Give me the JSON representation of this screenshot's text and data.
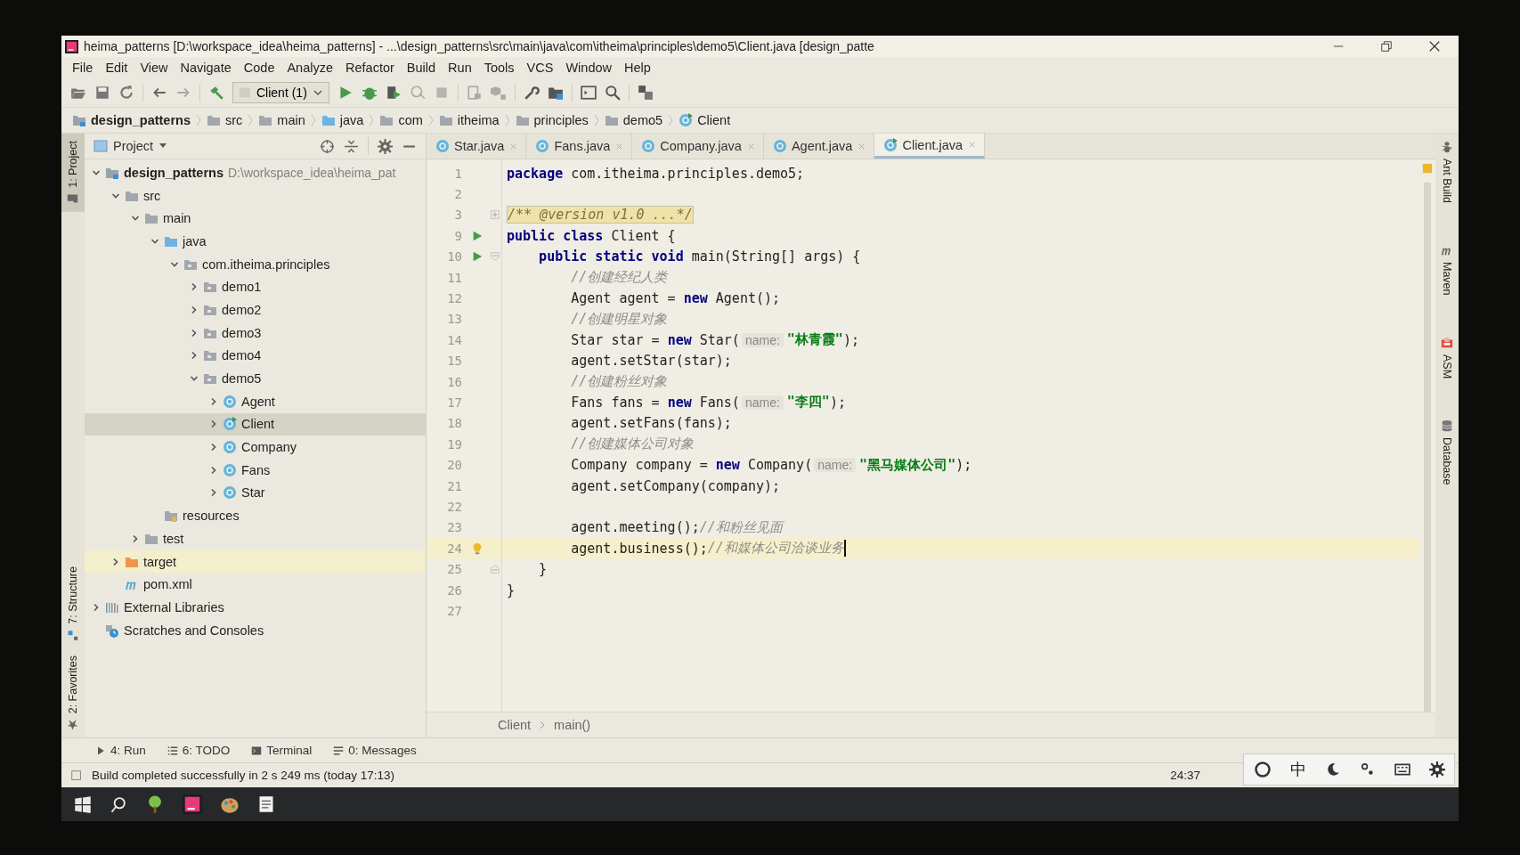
{
  "window": {
    "title": "heima_patterns [D:\\workspace_idea\\heima_patterns] - ...\\design_patterns\\src\\main\\java\\com\\itheima\\principles\\demo5\\Client.java [design_patte"
  },
  "menu": [
    "File",
    "Edit",
    "View",
    "Navigate",
    "Code",
    "Analyze",
    "Refactor",
    "Build",
    "Run",
    "Tools",
    "VCS",
    "Window",
    "Help"
  ],
  "toolbar": {
    "run_config": "Client (1)"
  },
  "breadcrumbs": [
    {
      "label": "design_patterns",
      "kind": "module"
    },
    {
      "label": "src",
      "kind": "folder"
    },
    {
      "label": "main",
      "kind": "folder"
    },
    {
      "label": "java",
      "kind": "source"
    },
    {
      "label": "com",
      "kind": "package"
    },
    {
      "label": "itheima",
      "kind": "package"
    },
    {
      "label": "principles",
      "kind": "package"
    },
    {
      "label": "demo5",
      "kind": "package"
    },
    {
      "label": "Client",
      "kind": "class"
    }
  ],
  "left_strip": [
    {
      "label": "1: Project",
      "selected": true
    },
    {
      "label": "7: Structure",
      "selected": false
    },
    {
      "label": "2: Favorites",
      "selected": false
    }
  ],
  "right_strip": [
    {
      "label": "Ant Build",
      "kind": "ant"
    },
    {
      "label": "Maven",
      "kind": "maven"
    },
    {
      "label": "ASM",
      "kind": "asm"
    },
    {
      "label": "Database",
      "kind": "database"
    }
  ],
  "project": {
    "title": "Project",
    "tree": [
      {
        "label": "design_patterns",
        "kind": "module",
        "path": "D:\\workspace_idea\\heima_pat",
        "expanded": true,
        "selected": false,
        "children": [
          {
            "label": "src",
            "kind": "folder",
            "expanded": true,
            "selected": false,
            "children": [
              {
                "label": "main",
                "kind": "folder",
                "expanded": true,
                "selected": false,
                "children": [
                  {
                    "label": "java",
                    "kind": "source",
                    "expanded": true,
                    "selected": false,
                    "children": [
                      {
                        "label": "com.itheima.principles",
                        "kind": "package",
                        "expanded": true,
                        "selected": false,
                        "children": [
                          {
                            "label": "demo1",
                            "kind": "package",
                            "expanded": false,
                            "selected": false
                          },
                          {
                            "label": "demo2",
                            "kind": "package",
                            "expanded": false,
                            "selected": false
                          },
                          {
                            "label": "demo3",
                            "kind": "package",
                            "expanded": false,
                            "selected": false
                          },
                          {
                            "label": "demo4",
                            "kind": "package",
                            "expanded": false,
                            "selected": false
                          },
                          {
                            "label": "demo5",
                            "kind": "package",
                            "expanded": true,
                            "selected": false,
                            "children": [
                              {
                                "label": "Agent",
                                "kind": "class",
                                "expanded": false,
                                "selected": false
                              },
                              {
                                "label": "Client",
                                "kind": "main-class",
                                "expanded": false,
                                "selected": true
                              },
                              {
                                "label": "Company",
                                "kind": "class",
                                "expanded": false,
                                "selected": false
                              },
                              {
                                "label": "Fans",
                                "kind": "class",
                                "expanded": false,
                                "selected": false
                              },
                              {
                                "label": "Star",
                                "kind": "class",
                                "expanded": false,
                                "selected": false
                              }
                            ]
                          }
                        ]
                      }
                    ]
                  },
                  {
                    "label": "resources",
                    "kind": "resources",
                    "selected": false
                  }
                ]
              },
              {
                "label": "test",
                "kind": "folder",
                "expanded": false,
                "selected": false
              }
            ]
          },
          {
            "label": "target",
            "kind": "excluded",
            "expanded": false,
            "selected": false
          },
          {
            "label": "pom.xml",
            "kind": "pom",
            "selected": false
          }
        ]
      },
      {
        "label": "External Libraries",
        "kind": "libraries",
        "expanded": false,
        "selected": false
      },
      {
        "label": "Scratches and Consoles",
        "kind": "scratches",
        "selected": false
      }
    ]
  },
  "editor": {
    "tabs": [
      {
        "label": "Star.java",
        "selected": false
      },
      {
        "label": "Fans.java",
        "selected": false
      },
      {
        "label": "Company.java",
        "selected": false
      },
      {
        "label": "Agent.java",
        "selected": false
      },
      {
        "label": "Client.java",
        "selected": true
      }
    ],
    "lines": [
      {
        "number": "1",
        "current": false,
        "run_icon": false,
        "bulb_icon": false,
        "fold_start": false,
        "fold_end": false,
        "tokens": [
          {
            "kind": "keyword",
            "text": "package"
          },
          {
            "kind": "plain",
            "text": " com.itheima.principles.demo5;"
          }
        ]
      },
      {
        "number": "2",
        "current": false,
        "run_icon": false,
        "bulb_icon": false,
        "fold_start": false,
        "fold_end": false
      },
      {
        "number": "3",
        "current": false,
        "run_icon": false,
        "bulb_icon": false,
        "fold_start": false,
        "fold_end": false,
        "tokens": [
          {
            "kind": "folded",
            "text": "/** @version v1.0 ...*/"
          }
        ]
      },
      {
        "number": "9",
        "current": false,
        "run_icon": true,
        "bulb_icon": false,
        "fold_start": false,
        "fold_end": false,
        "tokens": [
          {
            "kind": "keyword",
            "text": "public class"
          },
          {
            "kind": "plain",
            "text": " Client {"
          }
        ]
      },
      {
        "number": "10",
        "current": false,
        "run_icon": true,
        "bulb_icon": false,
        "fold_start": true,
        "fold_end": false,
        "tokens": [
          {
            "kind": "keyword",
            "text": "    public static void"
          },
          {
            "kind": "plain",
            "text": " main(String[] args) {"
          }
        ]
      },
      {
        "number": "11",
        "current": false,
        "run_icon": false,
        "bulb_icon": false,
        "fold_start": false,
        "fold_end": false,
        "tokens": [
          {
            "kind": "comment",
            "text": "        //创建经纪人类"
          }
        ]
      },
      {
        "number": "12",
        "current": false,
        "run_icon": false,
        "bulb_icon": false,
        "fold_start": false,
        "fold_end": false,
        "tokens": [
          {
            "kind": "plain",
            "text": "        Agent agent = "
          },
          {
            "kind": "keyword",
            "text": "new"
          },
          {
            "kind": "plain",
            "text": " Agent();"
          }
        ]
      },
      {
        "number": "13",
        "current": false,
        "run_icon": false,
        "bulb_icon": false,
        "fold_start": false,
        "fold_end": false,
        "tokens": [
          {
            "kind": "comment",
            "text": "        //创建明星对象"
          }
        ]
      },
      {
        "number": "14",
        "current": false,
        "run_icon": false,
        "bulb_icon": false,
        "fold_start": false,
        "fold_end": false,
        "tokens": [
          {
            "kind": "plain",
            "text": "        Star star = "
          },
          {
            "kind": "keyword",
            "text": "new"
          },
          {
            "kind": "plain",
            "text": " Star("
          },
          {
            "kind": "hint",
            "text": "name:"
          },
          {
            "kind": "string",
            "text": "\"林青霞\""
          },
          {
            "kind": "plain",
            "text": ");"
          }
        ]
      },
      {
        "number": "15",
        "current": false,
        "run_icon": false,
        "bulb_icon": false,
        "fold_start": false,
        "fold_end": false,
        "tokens": [
          {
            "kind": "plain",
            "text": "        agent.setStar(star);"
          }
        ]
      },
      {
        "number": "16",
        "current": false,
        "run_icon": false,
        "bulb_icon": false,
        "fold_start": false,
        "fold_end": false,
        "tokens": [
          {
            "kind": "comment",
            "text": "        //创建粉丝对象"
          }
        ]
      },
      {
        "number": "17",
        "current": false,
        "run_icon": false,
        "bulb_icon": false,
        "fold_start": false,
        "fold_end": false,
        "tokens": [
          {
            "kind": "plain",
            "text": "        Fans fans = "
          },
          {
            "kind": "keyword",
            "text": "new"
          },
          {
            "kind": "plain",
            "text": " Fans("
          },
          {
            "kind": "hint",
            "text": "name:"
          },
          {
            "kind": "string",
            "text": "\"李四\""
          },
          {
            "kind": "plain",
            "text": ");"
          }
        ]
      },
      {
        "number": "18",
        "current": false,
        "run_icon": false,
        "bulb_icon": false,
        "fold_start": false,
        "fold_end": false,
        "tokens": [
          {
            "kind": "plain",
            "text": "        agent.setFans(fans);"
          }
        ]
      },
      {
        "number": "19",
        "current": false,
        "run_icon": false,
        "bulb_icon": false,
        "fold_start": false,
        "fold_end": false,
        "tokens": [
          {
            "kind": "comment",
            "text": "        //创建媒体公司对象"
          }
        ]
      },
      {
        "number": "20",
        "current": false,
        "run_icon": false,
        "bulb_icon": false,
        "fold_start": false,
        "fold_end": false,
        "tokens": [
          {
            "kind": "plain",
            "text": "        Company company = "
          },
          {
            "kind": "keyword",
            "text": "new"
          },
          {
            "kind": "plain",
            "text": " Company("
          },
          {
            "kind": "hint",
            "text": "name:"
          },
          {
            "kind": "string",
            "text": "\"黑马媒体公司\""
          },
          {
            "kind": "plain",
            "text": ");"
          }
        ]
      },
      {
        "number": "21",
        "current": false,
        "run_icon": false,
        "bulb_icon": false,
        "fold_start": false,
        "fold_end": false,
        "tokens": [
          {
            "kind": "plain",
            "text": "        agent.setCompany(company);"
          }
        ]
      },
      {
        "number": "22",
        "current": false,
        "run_icon": false,
        "bulb_icon": false,
        "fold_start": false,
        "fold_end": false
      },
      {
        "number": "23",
        "current": false,
        "run_icon": false,
        "bulb_icon": false,
        "fold_start": false,
        "fold_end": false,
        "tokens": [
          {
            "kind": "plain",
            "text": "        agent.meeting();"
          },
          {
            "kind": "comment",
            "text": "//和粉丝见面"
          }
        ]
      },
      {
        "number": "24",
        "current": true,
        "run_icon": false,
        "bulb_icon": true,
        "fold_start": false,
        "fold_end": false,
        "caret": true,
        "tokens": [
          {
            "kind": "plain",
            "text": "        agent.business();"
          },
          {
            "kind": "comment",
            "text": "//和媒体公司洽谈业务"
          }
        ]
      },
      {
        "number": "25",
        "current": false,
        "run_icon": false,
        "bulb_icon": false,
        "fold_start": false,
        "fold_end": true,
        "tokens": [
          {
            "kind": "plain",
            "text": "    }"
          }
        ]
      },
      {
        "number": "26",
        "current": false,
        "run_icon": false,
        "bulb_icon": false,
        "fold_start": false,
        "fold_end": false,
        "tokens": [
          {
            "kind": "plain",
            "text": "}"
          }
        ]
      },
      {
        "number": "27",
        "current": false,
        "run_icon": false,
        "bulb_icon": false,
        "fold_start": false,
        "fold_end": false
      }
    ],
    "breadcrumbs": [
      "Client",
      "main()"
    ]
  },
  "bottom_tabs": [
    {
      "label": "4: Run",
      "kind": "run"
    },
    {
      "label": "6: TODO",
      "kind": "todo"
    },
    {
      "label": "Terminal",
      "kind": "terminal"
    },
    {
      "label": "0: Messages",
      "kind": "messages"
    }
  ],
  "status_bar": {
    "message": "Build completed successfully in 2 s 249 ms (today 17:13)",
    "position": "24:37"
  },
  "ime_bar": {
    "mode": "中"
  }
}
